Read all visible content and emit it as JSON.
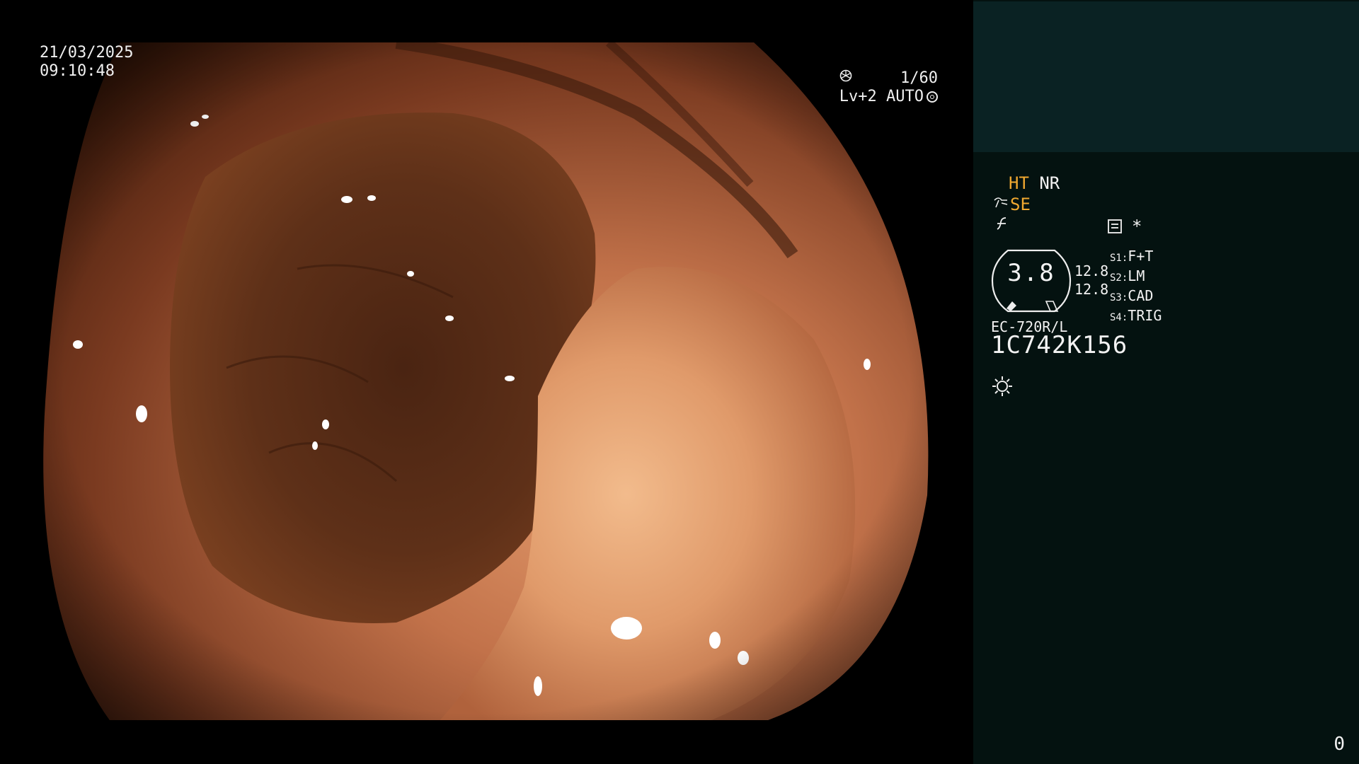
{
  "colors": {
    "panel_bg": "#041210",
    "thumb_bg": "#0a2223",
    "highlight": "#f0a830",
    "text": "#f2f2f2"
  },
  "overlay": {
    "date": "21/03/2025",
    "time": "09:10:48",
    "shutter": "1/60",
    "shutter_icon": "aperture-icon",
    "exposure": "Lv+2 AUTO",
    "exposure_icon": "auto-iris-icon"
  },
  "panel": {
    "mode_ht": "HT",
    "mode_nr": "NR",
    "mode_se": "SE",
    "structure_icon": "structure-enhance-icon",
    "filter_icon": "f-curve-icon",
    "memo_icon": "memo-icon",
    "memo_mark": "*",
    "gauge_value": "3.8",
    "level_1": "12.8",
    "level_2": "12.8",
    "switches": [
      {
        "key": "S1:",
        "value": "F+T"
      },
      {
        "key": "S2:",
        "value": "LM"
      },
      {
        "key": "S3:",
        "value": "CAD"
      },
      {
        "key": "S4:",
        "value": "TRIG"
      }
    ],
    "model": "EC-720R/L",
    "serial": "1C742K156",
    "light_icon": "light-source-icon",
    "counter": "0"
  }
}
